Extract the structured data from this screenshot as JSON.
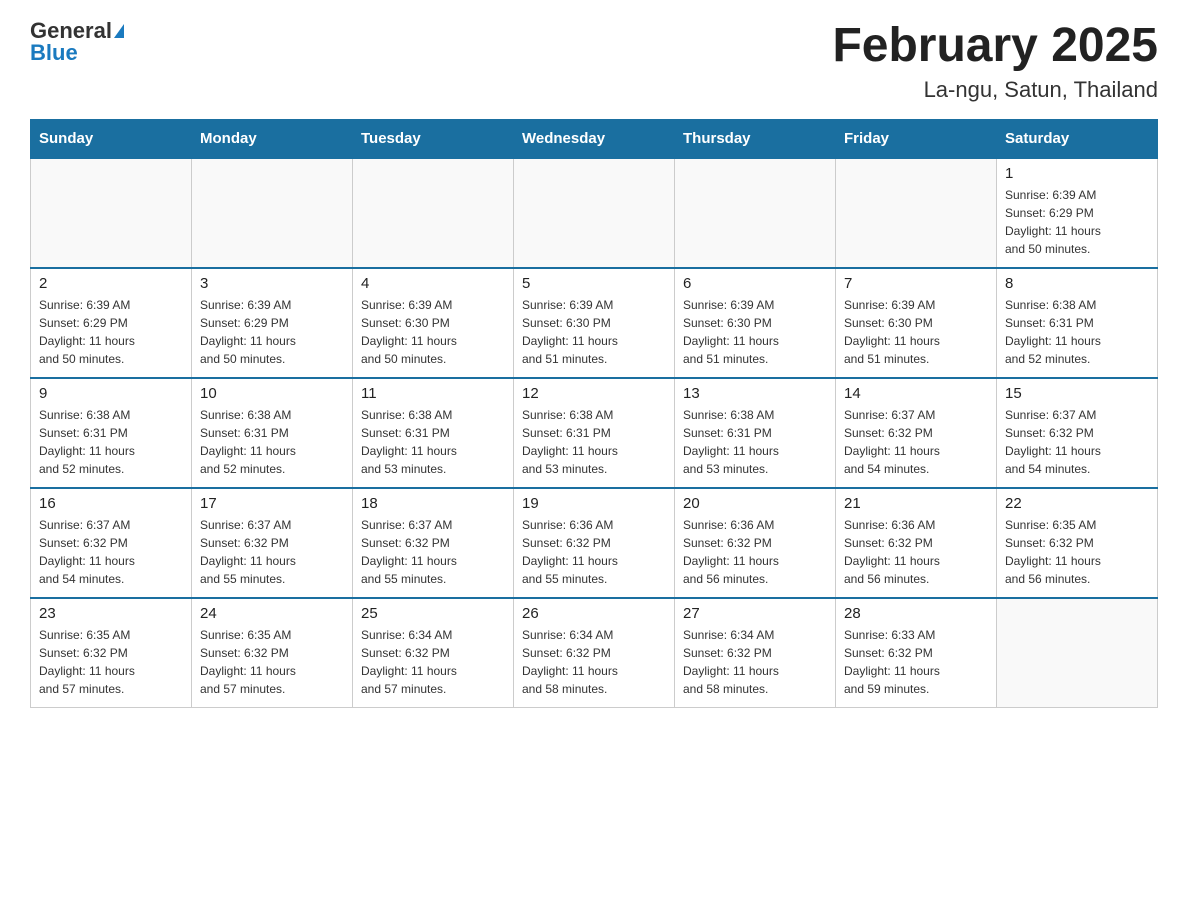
{
  "header": {
    "logo_general": "General",
    "logo_blue": "Blue",
    "month_title": "February 2025",
    "location": "La-ngu, Satun, Thailand"
  },
  "weekdays": [
    "Sunday",
    "Monday",
    "Tuesday",
    "Wednesday",
    "Thursday",
    "Friday",
    "Saturday"
  ],
  "weeks": [
    [
      {
        "day": "",
        "info": ""
      },
      {
        "day": "",
        "info": ""
      },
      {
        "day": "",
        "info": ""
      },
      {
        "day": "",
        "info": ""
      },
      {
        "day": "",
        "info": ""
      },
      {
        "day": "",
        "info": ""
      },
      {
        "day": "1",
        "info": "Sunrise: 6:39 AM\nSunset: 6:29 PM\nDaylight: 11 hours\nand 50 minutes."
      }
    ],
    [
      {
        "day": "2",
        "info": "Sunrise: 6:39 AM\nSunset: 6:29 PM\nDaylight: 11 hours\nand 50 minutes."
      },
      {
        "day": "3",
        "info": "Sunrise: 6:39 AM\nSunset: 6:29 PM\nDaylight: 11 hours\nand 50 minutes."
      },
      {
        "day": "4",
        "info": "Sunrise: 6:39 AM\nSunset: 6:30 PM\nDaylight: 11 hours\nand 50 minutes."
      },
      {
        "day": "5",
        "info": "Sunrise: 6:39 AM\nSunset: 6:30 PM\nDaylight: 11 hours\nand 51 minutes."
      },
      {
        "day": "6",
        "info": "Sunrise: 6:39 AM\nSunset: 6:30 PM\nDaylight: 11 hours\nand 51 minutes."
      },
      {
        "day": "7",
        "info": "Sunrise: 6:39 AM\nSunset: 6:30 PM\nDaylight: 11 hours\nand 51 minutes."
      },
      {
        "day": "8",
        "info": "Sunrise: 6:38 AM\nSunset: 6:31 PM\nDaylight: 11 hours\nand 52 minutes."
      }
    ],
    [
      {
        "day": "9",
        "info": "Sunrise: 6:38 AM\nSunset: 6:31 PM\nDaylight: 11 hours\nand 52 minutes."
      },
      {
        "day": "10",
        "info": "Sunrise: 6:38 AM\nSunset: 6:31 PM\nDaylight: 11 hours\nand 52 minutes."
      },
      {
        "day": "11",
        "info": "Sunrise: 6:38 AM\nSunset: 6:31 PM\nDaylight: 11 hours\nand 53 minutes."
      },
      {
        "day": "12",
        "info": "Sunrise: 6:38 AM\nSunset: 6:31 PM\nDaylight: 11 hours\nand 53 minutes."
      },
      {
        "day": "13",
        "info": "Sunrise: 6:38 AM\nSunset: 6:31 PM\nDaylight: 11 hours\nand 53 minutes."
      },
      {
        "day": "14",
        "info": "Sunrise: 6:37 AM\nSunset: 6:32 PM\nDaylight: 11 hours\nand 54 minutes."
      },
      {
        "day": "15",
        "info": "Sunrise: 6:37 AM\nSunset: 6:32 PM\nDaylight: 11 hours\nand 54 minutes."
      }
    ],
    [
      {
        "day": "16",
        "info": "Sunrise: 6:37 AM\nSunset: 6:32 PM\nDaylight: 11 hours\nand 54 minutes."
      },
      {
        "day": "17",
        "info": "Sunrise: 6:37 AM\nSunset: 6:32 PM\nDaylight: 11 hours\nand 55 minutes."
      },
      {
        "day": "18",
        "info": "Sunrise: 6:37 AM\nSunset: 6:32 PM\nDaylight: 11 hours\nand 55 minutes."
      },
      {
        "day": "19",
        "info": "Sunrise: 6:36 AM\nSunset: 6:32 PM\nDaylight: 11 hours\nand 55 minutes."
      },
      {
        "day": "20",
        "info": "Sunrise: 6:36 AM\nSunset: 6:32 PM\nDaylight: 11 hours\nand 56 minutes."
      },
      {
        "day": "21",
        "info": "Sunrise: 6:36 AM\nSunset: 6:32 PM\nDaylight: 11 hours\nand 56 minutes."
      },
      {
        "day": "22",
        "info": "Sunrise: 6:35 AM\nSunset: 6:32 PM\nDaylight: 11 hours\nand 56 minutes."
      }
    ],
    [
      {
        "day": "23",
        "info": "Sunrise: 6:35 AM\nSunset: 6:32 PM\nDaylight: 11 hours\nand 57 minutes."
      },
      {
        "day": "24",
        "info": "Sunrise: 6:35 AM\nSunset: 6:32 PM\nDaylight: 11 hours\nand 57 minutes."
      },
      {
        "day": "25",
        "info": "Sunrise: 6:34 AM\nSunset: 6:32 PM\nDaylight: 11 hours\nand 57 minutes."
      },
      {
        "day": "26",
        "info": "Sunrise: 6:34 AM\nSunset: 6:32 PM\nDaylight: 11 hours\nand 58 minutes."
      },
      {
        "day": "27",
        "info": "Sunrise: 6:34 AM\nSunset: 6:32 PM\nDaylight: 11 hours\nand 58 minutes."
      },
      {
        "day": "28",
        "info": "Sunrise: 6:33 AM\nSunset: 6:32 PM\nDaylight: 11 hours\nand 59 minutes."
      },
      {
        "day": "",
        "info": ""
      }
    ]
  ]
}
